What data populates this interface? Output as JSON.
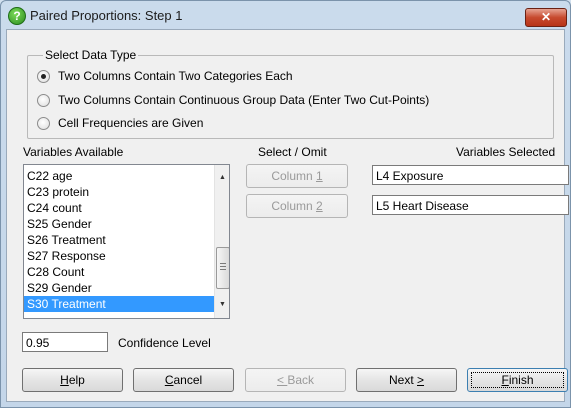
{
  "window": {
    "title": "Paired Proportions: Step 1",
    "close_glyph": "✕",
    "app_icon": "help-question-icon"
  },
  "data_type": {
    "legend": "Select Data Type",
    "options": [
      {
        "label": "Two Columns Contain Two Categories Each",
        "selected": true
      },
      {
        "label": "Two Columns Contain Continuous Group Data (Enter Two Cut-Points)",
        "selected": false
      },
      {
        "label": "Cell Frequencies are Given",
        "selected": false
      }
    ]
  },
  "variables_available": {
    "label": "Variables Available",
    "items": [
      "C22 age",
      "C23 protein",
      "C24 count",
      "S25 Gender",
      "S26 Treatment",
      "S27 Response",
      "C28 Count",
      "S29 Gender",
      "S30 Treatment"
    ],
    "selected_item": "S30 Treatment"
  },
  "select_omit": {
    "label": "Select / Omit",
    "column1": {
      "prefix": "Column ",
      "key": "1"
    },
    "column2": {
      "prefix": "Column ",
      "key": "2"
    }
  },
  "variables_selected": {
    "label": "Variables Selected",
    "fields": [
      "L4 Exposure",
      "L5 Heart Disease"
    ]
  },
  "confidence": {
    "value": "0.95",
    "label": "Confidence Level"
  },
  "buttons": {
    "help": {
      "key": "H",
      "rest": "elp"
    },
    "cancel": {
      "key": "C",
      "rest": "ancel"
    },
    "back": {
      "key": "< ",
      "rest": "Back"
    },
    "next": {
      "label": "Next ",
      "key": ">"
    },
    "finish": {
      "key": "F",
      "rest": "inish"
    }
  }
}
